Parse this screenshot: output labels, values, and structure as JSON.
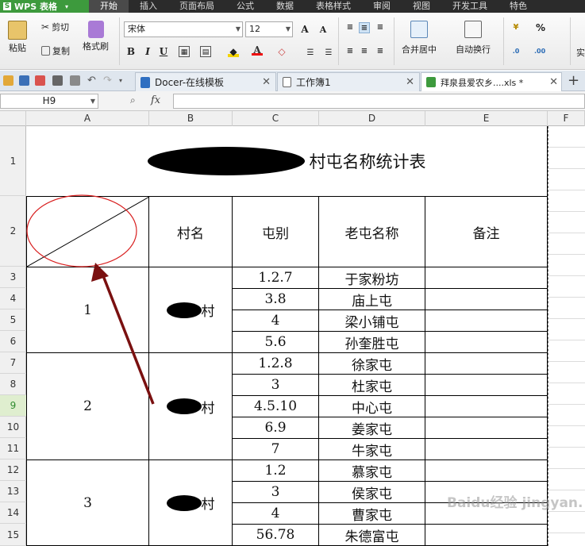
{
  "app": {
    "name": "WPS 表格"
  },
  "ribbon_tabs": [
    "开始",
    "插入",
    "页面布局",
    "公式",
    "数据",
    "表格样式",
    "审阅",
    "视图",
    "开发工具",
    "特色"
  ],
  "ribbon": {
    "cut": "剪切",
    "paste": "粘贴",
    "copy": "复制",
    "format_painter": "格式刷",
    "font_name": "宋体",
    "font_size": "12",
    "bold": "B",
    "italic": "I",
    "underline": "U",
    "merge_center": "合并居中",
    "wrap_text": "自动换行",
    "percent": "%",
    "more": "实"
  },
  "doc_tabs": [
    {
      "label": "Docer-在线模板"
    },
    {
      "label": "工作簿1"
    },
    {
      "label": "拜泉县爱农乡....xls *"
    }
  ],
  "formula_bar": {
    "cell_ref": "H9",
    "fx": "fx",
    "value": ""
  },
  "columns": [
    "A",
    "B",
    "C",
    "D",
    "E",
    "F"
  ],
  "rows": [
    "1",
    "2",
    "3",
    "4",
    "5",
    "6",
    "7",
    "8",
    "9",
    "10",
    "11",
    "12",
    "13",
    "14",
    "15"
  ],
  "selected_row": "9",
  "sheet": {
    "title_suffix": "村屯名称统计表",
    "headers": {
      "village": "村名",
      "tun_type": "屯别",
      "old_name": "老屯名称",
      "note": "备注"
    },
    "groups": [
      {
        "index": "1",
        "village_suffix": "村"
      },
      {
        "index": "2",
        "village_suffix": "村"
      },
      {
        "index": "3",
        "village_suffix": "村"
      }
    ],
    "rows": [
      {
        "tun": "1.2.7",
        "name": "于家粉坊"
      },
      {
        "tun": "3.8",
        "name": "庙上屯"
      },
      {
        "tun": "4",
        "name": "梁小铺屯"
      },
      {
        "tun": "5.6",
        "name": "孙奎胜屯"
      },
      {
        "tun": "1.2.8",
        "name": "徐家屯"
      },
      {
        "tun": "3",
        "name": "杜家屯"
      },
      {
        "tun": "4.5.10",
        "name": "中心屯"
      },
      {
        "tun": "6.9",
        "name": "姜家屯"
      },
      {
        "tun": "7",
        "name": "牛家屯"
      },
      {
        "tun": "1.2",
        "name": "慕家屯"
      },
      {
        "tun": "3",
        "name": "侯家屯"
      },
      {
        "tun": "4",
        "name": "曹家屯"
      },
      {
        "tun": "56.78",
        "name": "朱德富屯"
      }
    ]
  },
  "watermark": "Baidu经验 jingyan.baidu.com",
  "colors": {
    "annotation": "#d81e1e",
    "arrow": "#7a1010",
    "brand": "#3d9a3d"
  }
}
